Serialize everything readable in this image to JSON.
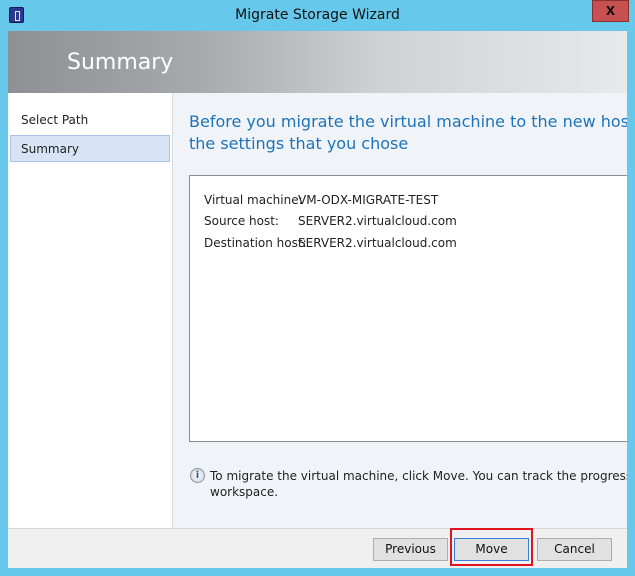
{
  "window": {
    "title": "Migrate Storage Wizard",
    "close_label": "X"
  },
  "header": {
    "title": "Summary"
  },
  "nav": {
    "items": [
      {
        "label": "Select Path",
        "selected": false
      },
      {
        "label": "Summary",
        "selected": true
      }
    ]
  },
  "main": {
    "heading": "Before you migrate the virtual machine to the new host, revi the settings that you chose",
    "heading_line1": "Before you migrate the virtual machine to the new host, revi",
    "heading_line2": "the settings that you chose",
    "summary": [
      {
        "label": "Virtual machine:",
        "value": "VM-ODX-MIGRATE-TEST"
      },
      {
        "label": "Source host:",
        "value": "SERVER2.virtualcloud.com"
      },
      {
        "label": "Destination host:",
        "value": "SERVER2.virtualcloud.com"
      }
    ],
    "info_line1": "To migrate the virtual machine, click Move. You can track the progress of thi",
    "info_line2": "workspace."
  },
  "footer": {
    "previous": "Previous",
    "move": "Move",
    "cancel": "Cancel"
  },
  "colors": {
    "accent": "#1e73b8",
    "highlight": "#e0141e",
    "frame": "#66c9ec"
  }
}
